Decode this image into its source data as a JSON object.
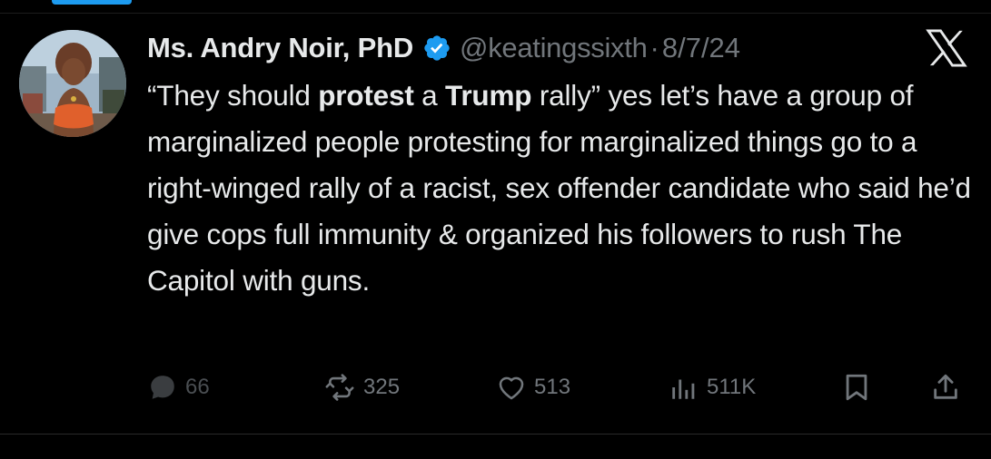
{
  "tweet": {
    "display_name": "Ms. Andry Noir, PhD",
    "handle": "@keatingssixth",
    "separator": "·",
    "date": "8/7/24",
    "text": {
      "part1": "“They should ",
      "bold1": "protest",
      "part2": " a ",
      "bold2": "Trump",
      "part3": " rally” yes let’s have a group of marginalized people protesting for marginalized things go to a right-winged rally of a racist, sex offender candidate who said he’d give cops full immunity & organized his followers to rush The Capitol with guns."
    }
  },
  "actions": {
    "replies": "66",
    "reposts": "325",
    "likes": "513",
    "views": "511K"
  },
  "icons": {
    "verified": "verified-badge-icon",
    "platform": "x-logo-icon",
    "reply": "reply-icon",
    "repost": "repost-icon",
    "like": "heart-icon",
    "views": "views-icon",
    "bookmark": "bookmark-icon",
    "share": "share-icon"
  },
  "colors": {
    "background": "#000000",
    "text": "#e7e9ea",
    "secondary": "#71767b",
    "accent": "#1d9bf0"
  }
}
